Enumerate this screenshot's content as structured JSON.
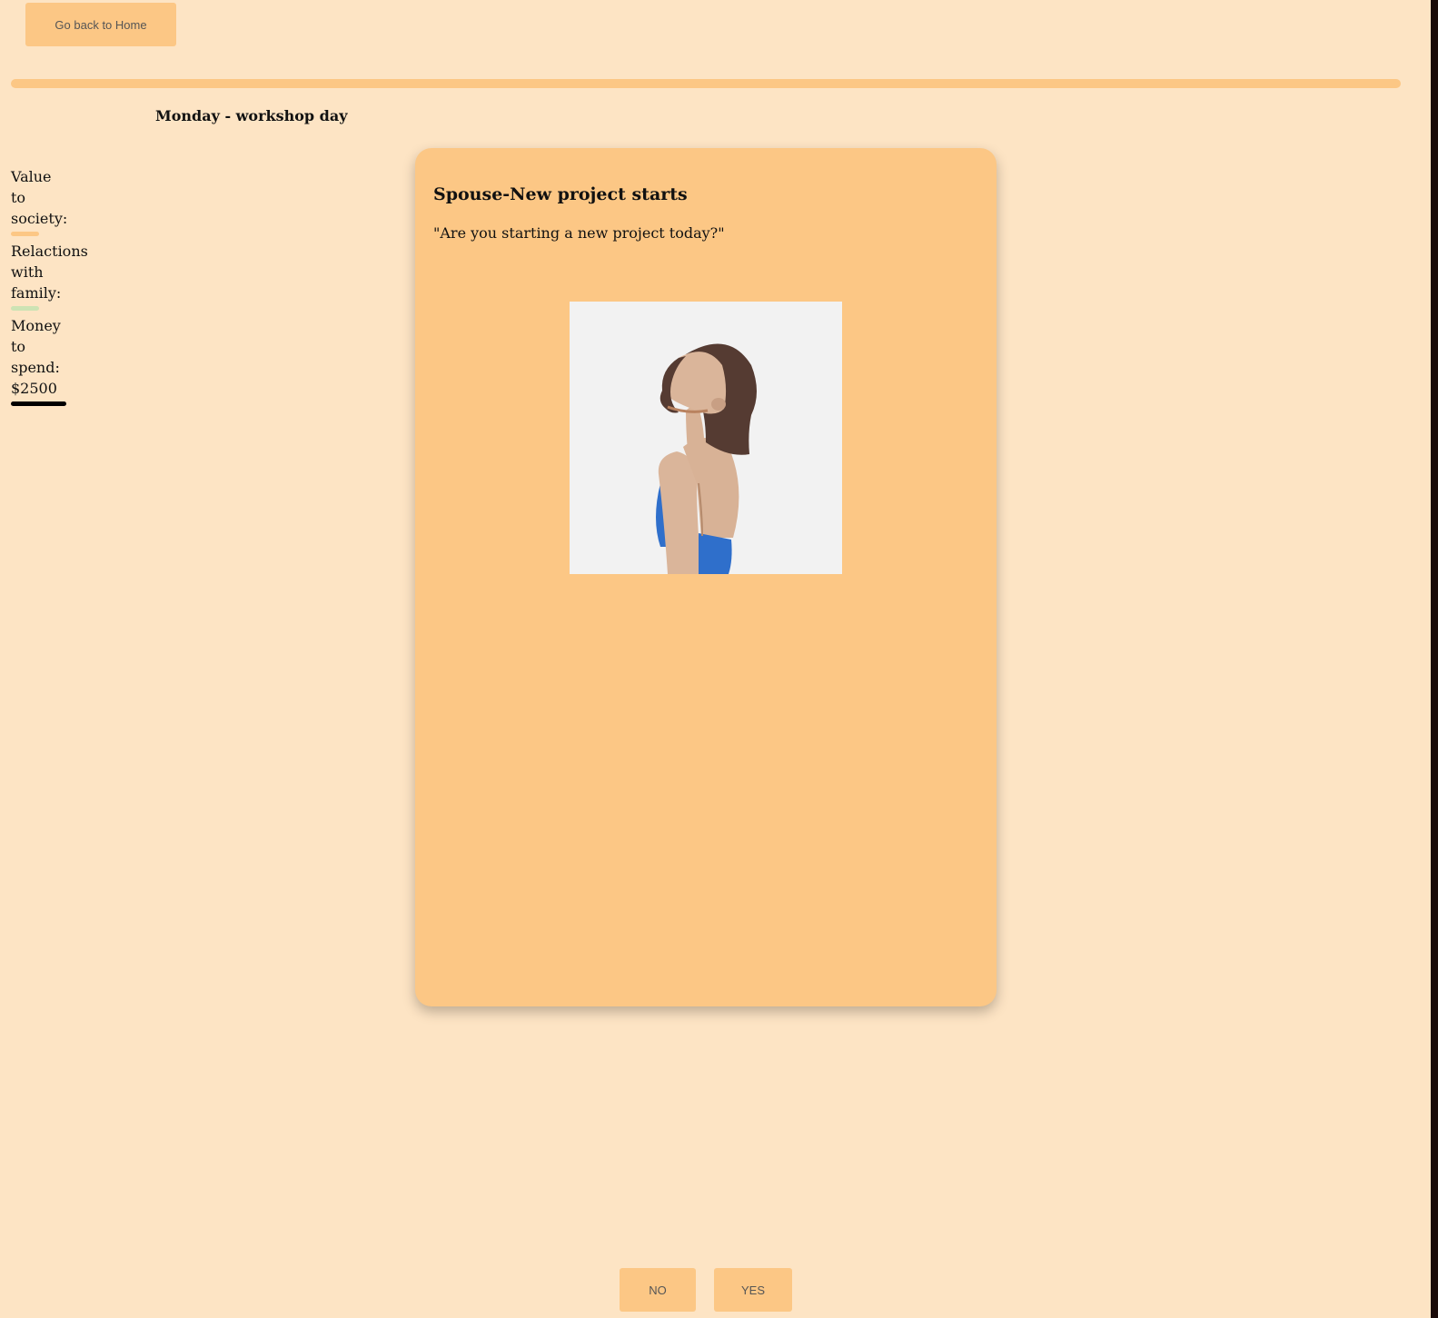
{
  "nav": {
    "home_label": "Go back to Home"
  },
  "progress": {
    "fraction": 1.0
  },
  "day": {
    "title": "Monday - workshop day"
  },
  "stats": [
    {
      "label": "Value to society:",
      "bar_fraction": 0.5,
      "color": "#fcc785"
    },
    {
      "label": "Relactions with family:",
      "bar_fraction": 0.5,
      "color": "#cde3b4"
    },
    {
      "label": "Money to spend: $2500",
      "bar_fraction": 1.0,
      "color": "#000000"
    }
  ],
  "card": {
    "title": "Spouse-New project starts",
    "text": "\"Are you starting a new project today?\"",
    "portrait": "woman-profile-portrait"
  },
  "choices": {
    "no_label": "NO",
    "yes_label": "YES"
  },
  "colors": {
    "background": "#fde4c4",
    "accent": "#fcc785"
  }
}
